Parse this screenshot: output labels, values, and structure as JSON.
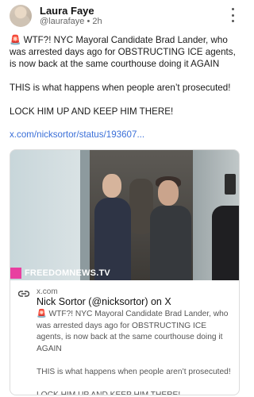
{
  "post": {
    "author_name": "Laura Faye",
    "author_handle": "@laurafaye",
    "separator": "•",
    "timestamp": "2h",
    "text": "🚨 WTF?! NYC Mayoral Candidate Brad Lander, who was arrested days ago for OBSTRUCTING ICE agents, is now back at the same courthouse doing it AGAIN\n\nTHIS is what happens when people aren’t prosecuted!\n\nLOCK HIM UP AND KEEP HIM THERE!",
    "link_text": "x.com/nicksortor/status/193607..."
  },
  "card": {
    "watermark": "FREEDOMNEWS.TV",
    "domain": "x.com",
    "title": "Nick Sortor (@nicksortor) on X",
    "description": "🚨 WTF?! NYC Mayoral Candidate Brad Lander, who was arrested days ago for OBSTRUCTING ICE agents, is now back at the same courthouse doing it AGAIN\n\nTHIS is what happens when people aren’t prosecuted!\n\nLOCK HIM UP AND KEEP HIM THERE!"
  },
  "icons": {
    "more": "more-vertical-icon",
    "link": "link-icon"
  },
  "colors": {
    "link": "#3a6fd8",
    "watermark_accent": "#e83fa0"
  }
}
